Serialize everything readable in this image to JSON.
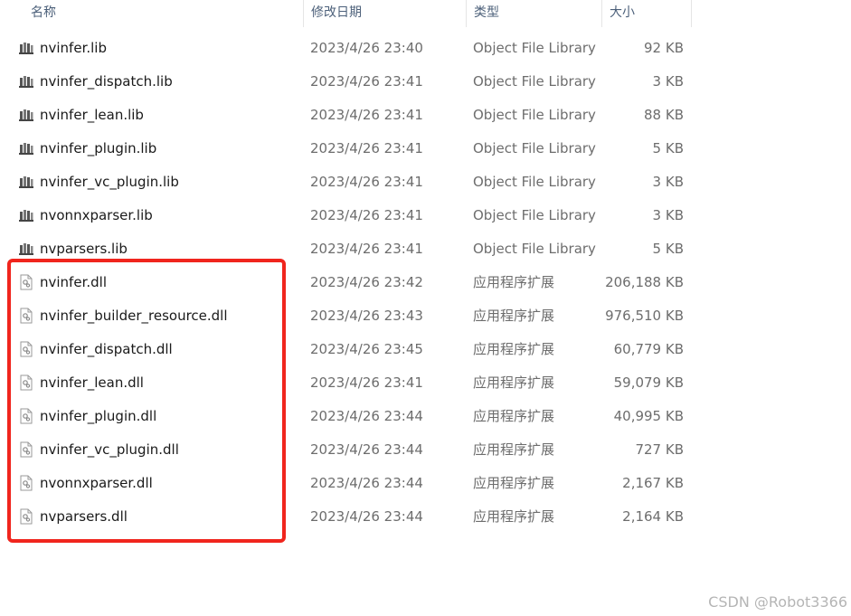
{
  "header": {
    "name": "名称",
    "date": "修改日期",
    "type": "类型",
    "size": "大小",
    "sort_indicator": "^"
  },
  "files": [
    {
      "name": "nvinfer.lib",
      "date": "2023/4/26 23:40",
      "type": "Object File Library",
      "size": "92 KB",
      "icon": "lib-icon"
    },
    {
      "name": "nvinfer_dispatch.lib",
      "date": "2023/4/26 23:41",
      "type": "Object File Library",
      "size": "3 KB",
      "icon": "lib-icon"
    },
    {
      "name": "nvinfer_lean.lib",
      "date": "2023/4/26 23:41",
      "type": "Object File Library",
      "size": "88 KB",
      "icon": "lib-icon"
    },
    {
      "name": "nvinfer_plugin.lib",
      "date": "2023/4/26 23:41",
      "type": "Object File Library",
      "size": "5 KB",
      "icon": "lib-icon"
    },
    {
      "name": "nvinfer_vc_plugin.lib",
      "date": "2023/4/26 23:41",
      "type": "Object File Library",
      "size": "3 KB",
      "icon": "lib-icon"
    },
    {
      "name": "nvonnxparser.lib",
      "date": "2023/4/26 23:41",
      "type": "Object File Library",
      "size": "3 KB",
      "icon": "lib-icon"
    },
    {
      "name": "nvparsers.lib",
      "date": "2023/4/26 23:41",
      "type": "Object File Library",
      "size": "5 KB",
      "icon": "lib-icon"
    },
    {
      "name": "nvinfer.dll",
      "date": "2023/4/26 23:42",
      "type": "应用程序扩展",
      "size": "206,188 KB",
      "icon": "dll-icon"
    },
    {
      "name": "nvinfer_builder_resource.dll",
      "date": "2023/4/26 23:43",
      "type": "应用程序扩展",
      "size": "976,510 KB",
      "icon": "dll-icon"
    },
    {
      "name": "nvinfer_dispatch.dll",
      "date": "2023/4/26 23:45",
      "type": "应用程序扩展",
      "size": "60,779 KB",
      "icon": "dll-icon"
    },
    {
      "name": "nvinfer_lean.dll",
      "date": "2023/4/26 23:41",
      "type": "应用程序扩展",
      "size": "59,079 KB",
      "icon": "dll-icon"
    },
    {
      "name": "nvinfer_plugin.dll",
      "date": "2023/4/26 23:44",
      "type": "应用程序扩展",
      "size": "40,995 KB",
      "icon": "dll-icon"
    },
    {
      "name": "nvinfer_vc_plugin.dll",
      "date": "2023/4/26 23:44",
      "type": "应用程序扩展",
      "size": "727 KB",
      "icon": "dll-icon"
    },
    {
      "name": "nvonnxparser.dll",
      "date": "2023/4/26 23:44",
      "type": "应用程序扩展",
      "size": "2,167 KB",
      "icon": "dll-icon"
    },
    {
      "name": "nvparsers.dll",
      "date": "2023/4/26 23:44",
      "type": "应用程序扩展",
      "size": "2,164 KB",
      "icon": "dll-icon"
    }
  ],
  "colors": {
    "highlight_border": "#f0251d",
    "header_text": "#4c607a",
    "secondary_text": "#6d6d6d"
  },
  "watermark": "CSDN @Robot3366"
}
